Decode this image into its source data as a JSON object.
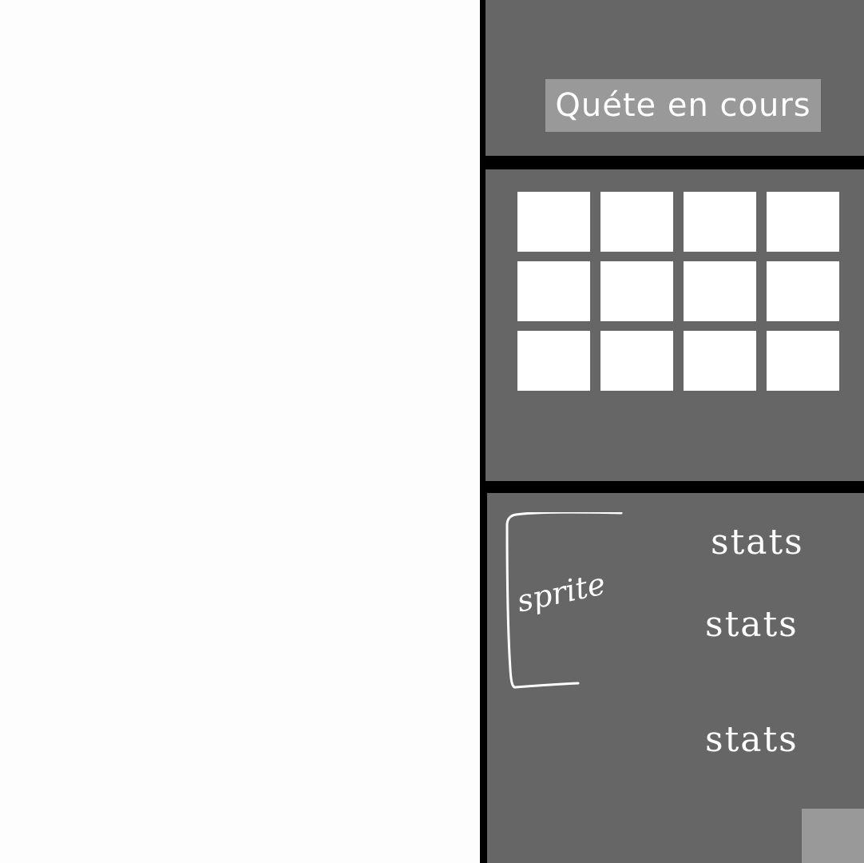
{
  "quest": {
    "button_label": "Quéte en cours"
  },
  "inventory": {
    "slot_count": 12
  },
  "character": {
    "sprite_label": "sprite"
  },
  "stats": [
    {
      "label": "stats"
    },
    {
      "label": "stats"
    },
    {
      "label": "stats"
    }
  ],
  "colors": {
    "panel": "#666666",
    "divider": "#000000",
    "button": "#999999",
    "slot": "#ffffff",
    "game_area": "#fdfdfd"
  }
}
